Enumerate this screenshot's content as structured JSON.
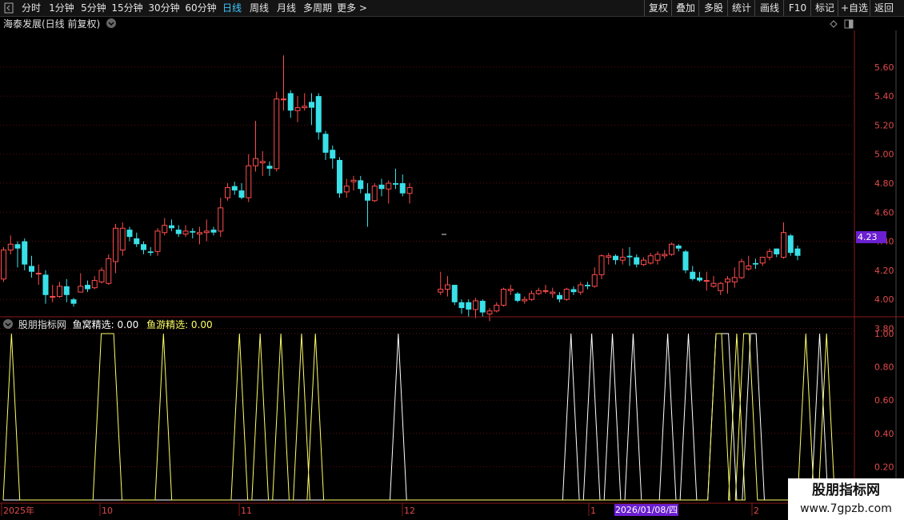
{
  "toolbar": {
    "periods": [
      "分时",
      "1分钟",
      "5分钟",
      "15分钟",
      "30分钟",
      "60分钟",
      "日线",
      "周线",
      "月线",
      "多周期",
      "更多 >"
    ],
    "active_period": "日线",
    "tools": [
      "复权",
      "叠加",
      "多股",
      "统计",
      "画线",
      "F10",
      "标记",
      "+自选",
      "返回"
    ]
  },
  "main_panel": {
    "title": "海泰发展(日线 前复权)",
    "last_price": "4.23",
    "y_ticks": [
      "5.60",
      "5.40",
      "5.20",
      "5.00",
      "4.80",
      "4.60",
      "4.40",
      "4.20",
      "4.00",
      "3.80"
    ]
  },
  "indicator_panel": {
    "name": "股朋指标网",
    "series1_label": "鱼窝精选: 0.00",
    "series2_label": "鱼游精选: 0.00",
    "y_ticks": [
      "1.00",
      "0.80",
      "0.60",
      "0.40",
      "0.20"
    ]
  },
  "x_axis": {
    "labels": [
      "2025年",
      "10",
      "11",
      "12",
      "1",
      "2"
    ],
    "crosshair_date": "2026/01/08/四"
  },
  "watermark": {
    "line1": "股朋指标网",
    "line2": "www.7gpzb.com"
  },
  "chart_data": [
    {
      "type": "candlestick",
      "title": "海泰发展(日线 前复权)",
      "ylim": [
        3.75,
        5.75
      ],
      "colors": {
        "up": "#ff4d4d",
        "down": "#39e0e8"
      },
      "candles": [
        [
          4.14,
          4.34,
          4.36,
          4.12
        ],
        [
          4.34,
          4.38,
          4.44,
          4.31
        ],
        [
          4.38,
          4.35,
          4.4,
          4.22
        ],
        [
          4.4,
          4.24,
          4.42,
          4.2
        ],
        [
          4.23,
          4.19,
          4.3,
          4.15
        ],
        [
          4.18,
          4.18,
          4.24,
          4.1
        ],
        [
          4.17,
          4.03,
          4.2,
          3.97
        ],
        [
          4.02,
          4.02,
          4.1,
          3.98
        ],
        [
          4.02,
          4.09,
          4.12,
          4.01
        ],
        [
          4.09,
          4.03,
          4.14,
          3.98
        ],
        [
          4.0,
          3.97,
          4.01,
          3.95
        ],
        [
          4.05,
          4.09,
          4.18,
          4.06
        ],
        [
          4.1,
          4.07,
          4.13,
          4.05
        ],
        [
          4.08,
          4.13,
          4.16,
          4.07
        ],
        [
          4.12,
          4.2,
          4.22,
          4.11
        ],
        [
          4.11,
          4.28,
          4.31,
          4.1
        ],
        [
          4.26,
          4.49,
          4.52,
          4.18
        ],
        [
          4.34,
          4.49,
          4.53,
          4.3
        ],
        [
          4.48,
          4.43,
          4.5,
          4.4
        ],
        [
          4.42,
          4.38,
          4.46,
          4.36
        ],
        [
          4.38,
          4.34,
          4.4,
          4.31
        ],
        [
          4.33,
          4.32,
          4.36,
          4.3
        ],
        [
          4.33,
          4.47,
          4.49,
          4.3
        ],
        [
          4.46,
          4.51,
          4.56,
          4.44
        ],
        [
          4.51,
          4.49,
          4.55,
          4.47
        ],
        [
          4.48,
          4.45,
          4.51,
          4.43
        ],
        [
          4.45,
          4.47,
          4.51,
          4.43
        ],
        [
          4.47,
          4.46,
          4.49,
          4.42
        ],
        [
          4.45,
          4.46,
          4.5,
          4.38
        ],
        [
          4.46,
          4.47,
          4.55,
          4.4
        ],
        [
          4.48,
          4.46,
          4.5,
          4.44
        ],
        [
          4.47,
          4.63,
          4.7,
          4.43
        ],
        [
          4.7,
          4.77,
          4.8,
          4.68
        ],
        [
          4.78,
          4.75,
          4.81,
          4.72
        ],
        [
          4.75,
          4.7,
          4.8,
          4.69
        ],
        [
          4.7,
          4.92,
          5.0,
          4.67
        ],
        [
          4.92,
          4.97,
          5.23,
          4.88
        ],
        [
          4.94,
          4.95,
          5.02,
          4.85
        ],
        [
          4.92,
          4.9,
          4.95,
          4.85
        ],
        [
          4.9,
          5.38,
          5.43,
          4.88
        ],
        [
          5.38,
          5.38,
          5.68,
          5.3
        ],
        [
          5.42,
          5.3,
          5.44,
          5.25
        ],
        [
          5.3,
          5.32,
          5.4,
          5.22
        ],
        [
          5.32,
          5.33,
          5.42,
          5.3
        ],
        [
          5.36,
          5.32,
          5.42,
          5.2
        ],
        [
          5.4,
          5.15,
          5.42,
          5.1
        ],
        [
          5.14,
          5.01,
          5.16,
          4.96
        ],
        [
          5.03,
          4.97,
          5.06,
          4.9
        ],
        [
          4.96,
          4.73,
          4.98,
          4.7
        ],
        [
          4.74,
          4.78,
          4.83,
          4.7
        ],
        [
          4.81,
          4.82,
          4.85,
          4.75
        ],
        [
          4.82,
          4.76,
          4.85,
          4.73
        ],
        [
          4.73,
          4.68,
          4.8,
          4.5
        ],
        [
          4.68,
          4.78,
          4.8,
          4.67
        ],
        [
          4.79,
          4.76,
          4.83,
          4.71
        ],
        [
          4.76,
          4.8,
          4.82,
          4.66
        ],
        [
          4.8,
          4.79,
          4.9,
          4.76
        ],
        [
          4.8,
          4.73,
          4.86,
          4.71
        ],
        [
          4.73,
          4.77,
          4.8,
          4.66
        ],
        [
          4.05,
          4.07,
          4.19,
          4.03
        ],
        [
          4.07,
          4.1,
          4.16,
          4.02
        ],
        [
          4.1,
          3.98,
          4.1,
          3.96
        ],
        [
          3.98,
          3.94,
          4.0,
          3.9
        ],
        [
          3.98,
          3.93,
          4.0,
          3.88
        ],
        [
          3.93,
          3.99,
          4.01,
          3.87
        ],
        [
          3.99,
          3.91,
          4.0,
          3.88
        ],
        [
          3.9,
          3.92,
          3.94,
          3.85
        ],
        [
          3.92,
          3.96,
          3.98,
          3.91
        ],
        [
          3.96,
          4.07,
          4.08,
          3.95
        ],
        [
          4.06,
          4.07,
          4.1,
          4.03
        ],
        [
          4.04,
          3.99,
          4.05,
          3.98
        ],
        [
          3.99,
          4.0,
          4.02,
          3.97
        ],
        [
          4.0,
          4.04,
          4.06,
          3.99
        ],
        [
          4.04,
          4.06,
          4.08,
          4.03
        ],
        [
          4.06,
          4.06,
          4.1,
          4.04
        ],
        [
          4.04,
          4.05,
          4.08,
          4.01
        ],
        [
          4.03,
          4.0,
          4.05,
          3.98
        ],
        [
          4.0,
          4.07,
          4.08,
          3.99
        ],
        [
          4.07,
          4.05,
          4.09,
          4.03
        ],
        [
          4.05,
          4.1,
          4.12,
          4.03
        ],
        [
          4.1,
          4.09,
          4.12,
          4.07
        ],
        [
          4.09,
          4.17,
          4.22,
          4.08
        ],
        [
          4.17,
          4.3,
          4.31,
          4.14
        ],
        [
          4.29,
          4.3,
          4.32,
          4.24
        ],
        [
          4.3,
          4.27,
          4.31,
          4.24
        ],
        [
          4.27,
          4.29,
          4.35,
          4.24
        ],
        [
          4.3,
          4.29,
          4.36,
          4.23
        ],
        [
          4.29,
          4.24,
          4.31,
          4.22
        ],
        [
          4.24,
          4.27,
          4.29,
          4.23
        ],
        [
          4.25,
          4.3,
          4.32,
          4.24
        ],
        [
          4.27,
          4.31,
          4.33,
          4.24
        ],
        [
          4.3,
          4.31,
          4.34,
          4.28
        ],
        [
          4.31,
          4.38,
          4.39,
          4.3
        ],
        [
          4.37,
          4.35,
          4.38,
          4.33
        ],
        [
          4.33,
          4.2,
          4.34,
          4.18
        ],
        [
          4.19,
          4.14,
          4.23,
          4.13
        ],
        [
          4.15,
          4.13,
          4.19,
          4.12
        ],
        [
          4.13,
          4.13,
          4.19,
          4.06
        ],
        [
          4.09,
          4.11,
          4.16,
          4.08
        ],
        [
          4.06,
          4.11,
          4.12,
          4.03
        ],
        [
          4.12,
          4.14,
          4.16,
          4.04
        ],
        [
          4.12,
          4.15,
          4.22,
          4.08
        ],
        [
          4.15,
          4.26,
          4.28,
          4.14
        ],
        [
          4.21,
          4.23,
          4.3,
          4.2
        ],
        [
          4.25,
          4.24,
          4.28,
          4.21
        ],
        [
          4.25,
          4.29,
          4.29,
          4.23
        ],
        [
          4.29,
          4.33,
          4.35,
          4.27
        ],
        [
          4.35,
          4.31,
          4.35,
          4.29
        ],
        [
          4.29,
          4.46,
          4.53,
          4.28
        ],
        [
          4.44,
          4.32,
          4.45,
          4.3
        ],
        [
          4.35,
          4.3,
          4.37,
          4.27
        ]
      ]
    },
    {
      "type": "line",
      "ylim": [
        0,
        1.1
      ],
      "series": [
        {
          "name": "鱼窝精选",
          "color": "#ffffff",
          "pulses": [
            [
              56,
              57
            ],
            [
              81,
              82
            ],
            [
              84,
              85
            ],
            [
              87,
              88
            ],
            [
              90,
              91
            ],
            [
              95,
              96
            ],
            [
              98,
              99
            ],
            [
              102,
              105
            ],
            [
              107,
              109
            ],
            [
              117,
              118
            ]
          ]
        },
        {
          "name": "鱼游精选",
          "color": "#ffff66",
          "pulses": [
            [
              0,
              1
            ],
            [
              13,
              16
            ],
            [
              22,
              23
            ],
            [
              33,
              34
            ],
            [
              36,
              37
            ],
            [
              39,
              40
            ],
            [
              42,
              43
            ],
            [
              44,
              45
            ],
            [
              102,
              104
            ],
            [
              105,
              106
            ],
            [
              106,
              108
            ],
            [
              115,
              116
            ],
            [
              118,
              119
            ]
          ]
        }
      ]
    }
  ]
}
